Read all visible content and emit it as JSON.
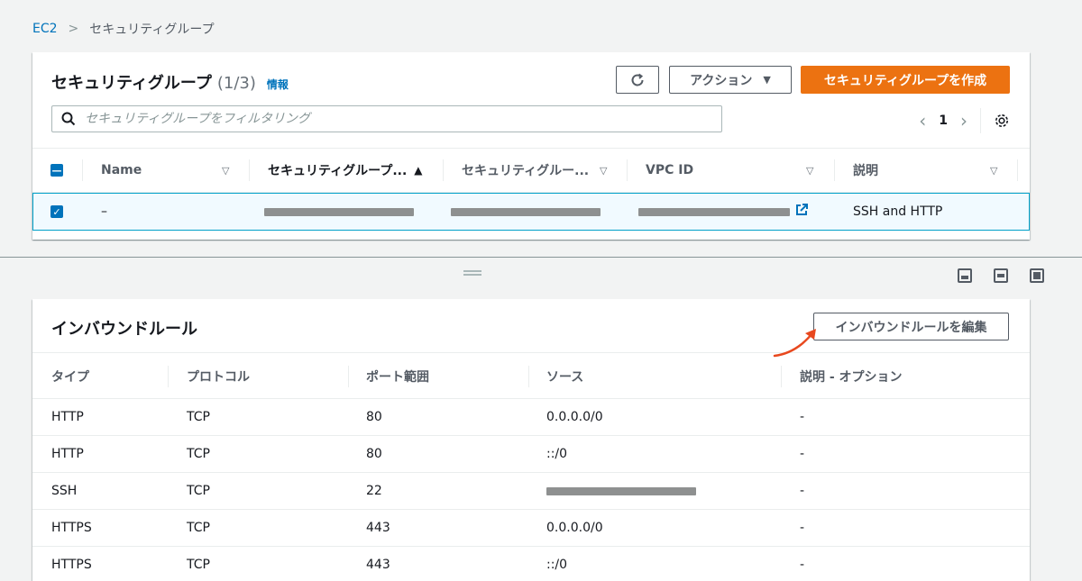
{
  "breadcrumb": {
    "root": "EC2",
    "separator": ">",
    "current": "セキュリティグループ"
  },
  "security_groups": {
    "title": "セキュリティグループ",
    "count": "(1/3)",
    "info": "情報",
    "action_label": "アクション",
    "create_label": "セキュリティグループを作成",
    "search_placeholder": "セキュリティグループをフィルタリング",
    "page": "1",
    "columns": [
      "Name",
      "セキュリティグループ...",
      "セキュリティグルー...",
      "VPC ID",
      "説明"
    ],
    "row": {
      "name": "–",
      "description": "SSH and HTTP"
    }
  },
  "inbound": {
    "title": "インバウンドルール",
    "edit_label": "インバウンドルールを編集",
    "columns": [
      "タイプ",
      "プロトコル",
      "ポート範囲",
      "ソース",
      "説明 - オプション"
    ],
    "rows": [
      {
        "type": "HTTP",
        "protocol": "TCP",
        "port": "80",
        "source": "0.0.0.0/0",
        "desc": "-"
      },
      {
        "type": "HTTP",
        "protocol": "TCP",
        "port": "80",
        "source": "::/0",
        "desc": "-"
      },
      {
        "type": "SSH",
        "protocol": "TCP",
        "port": "22",
        "source": "",
        "desc": "-"
      },
      {
        "type": "HTTPS",
        "protocol": "TCP",
        "port": "443",
        "source": "0.0.0.0/0",
        "desc": "-"
      },
      {
        "type": "HTTPS",
        "protocol": "TCP",
        "port": "443",
        "source": "::/0",
        "desc": "-"
      }
    ]
  },
  "colors": {
    "accent": "#0073bb",
    "primary_button": "#ec7211",
    "selected_row": "#f1faff",
    "arrow": "#e8481e"
  }
}
